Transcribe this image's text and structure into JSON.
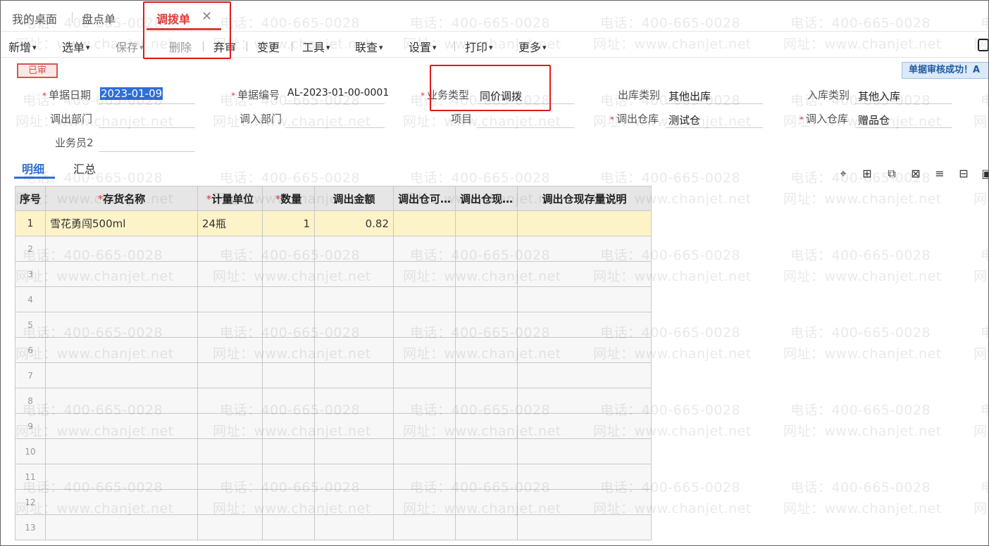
{
  "tabs": [
    {
      "label": "我的桌面"
    },
    {
      "label": "盘点单"
    },
    {
      "label": "调拨单"
    }
  ],
  "toolbar": {
    "new": "新增",
    "select": "选单",
    "save": "保存",
    "delete": "删除",
    "abandon": "弃审",
    "change": "变更",
    "tools": "工具",
    "linkquery": "联查",
    "settings": "设置",
    "print": "打印",
    "more": "更多"
  },
  "status_badge": "已审",
  "toast": "单据审核成功！A",
  "form": {
    "date_label": "单据日期",
    "date_value": "2023-01-09",
    "code_label": "单据编号",
    "code_value": "AL-2023-01-00-0001",
    "biz_type_label": "业务类型",
    "biz_type_value": "同价调拨",
    "out_type_label": "出库类别",
    "out_type_value": "其他出库",
    "in_type_label": "入库类别",
    "in_type_value": "其他入库",
    "out_dept_label": "调出部门",
    "in_dept_label": "调入部门",
    "project_label": "项目",
    "out_wh_label": "调出仓库",
    "out_wh_value": "测试仓",
    "in_wh_label": "调入仓库",
    "in_wh_value": "赠品仓",
    "salesman_label": "业务员2"
  },
  "subtabs": {
    "detail": "明细",
    "summary": "汇总"
  },
  "grid": {
    "headers": {
      "idx": "序号",
      "name": "存货名称",
      "unit": "计量单位",
      "qty": "数量",
      "amount": "调出金额",
      "avail": "调出仓可…",
      "current": "调出仓现…",
      "note": "调出仓现存量说明"
    },
    "row1": {
      "idx": "1",
      "name": "雪花勇闯500ml",
      "unit": "24瓶",
      "qty": "1",
      "amount": "0.82"
    },
    "empty_rows": [
      "2",
      "3",
      "4",
      "5",
      "6",
      "7",
      "8",
      "9",
      "10",
      "11",
      "12",
      "13"
    ]
  },
  "watermark": {
    "phone": "电话：400-665-0028",
    "site": "网址：www.chanjet.net"
  },
  "colors": {
    "accent_red": "#e03a3a",
    "accent_blue": "#2e6fd8",
    "selected_row": "#fdf3c8"
  }
}
